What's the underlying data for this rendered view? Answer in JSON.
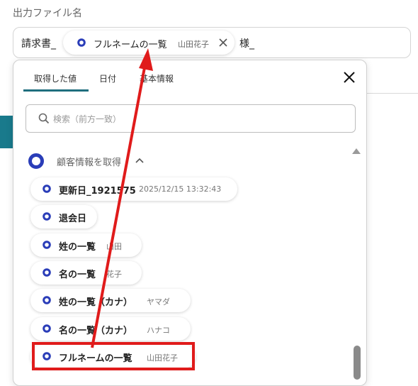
{
  "output_filename": {
    "label": "出力ファイル名",
    "prefix": "請求書_",
    "chip": {
      "name": "フルネームの一覧",
      "value": "山田花子"
    },
    "suffix": "様_"
  },
  "tabs": [
    {
      "label": "取得した値"
    },
    {
      "label": "日付"
    },
    {
      "label": "基本情報"
    }
  ],
  "search": {
    "placeholder": "検索（前方一致）",
    "value": ""
  },
  "group": {
    "title": "顧客情報を取得"
  },
  "items": [
    {
      "name": "更新日_1921575",
      "value": "2025/12/15 13:32:43"
    },
    {
      "name": "退会日",
      "value": ""
    },
    {
      "name": "姓の一覧",
      "value": "山田"
    },
    {
      "name": "名の一覧",
      "value": "花子"
    },
    {
      "name": "姓の一覧（カナ）",
      "value": "ヤマダ"
    },
    {
      "name": "名の一覧（カナ）",
      "value": "ハナコ"
    },
    {
      "name": "フルネームの一覧",
      "value": "山田花子"
    }
  ],
  "colors": {
    "ring": "#2a3db8",
    "annotation": "#e01b1b",
    "accent": "#1f6e7e"
  },
  "icons": {
    "close": "close-icon",
    "search": "search-icon",
    "chevron": "chevron-up-icon"
  }
}
